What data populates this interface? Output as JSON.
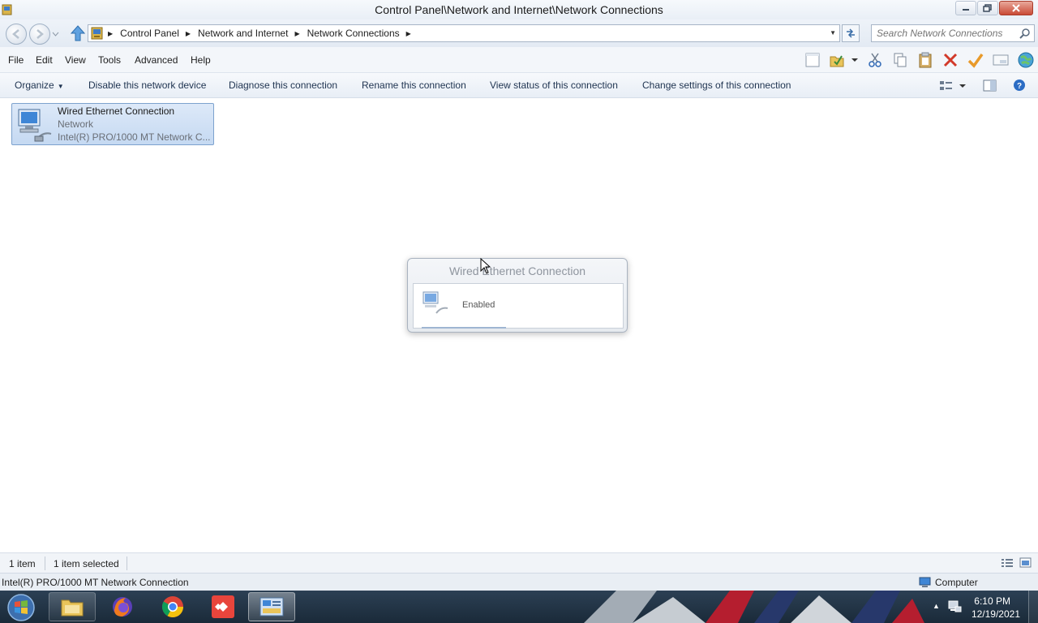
{
  "window": {
    "title": "Control Panel\\Network and Internet\\Network Connections"
  },
  "address": {
    "crumbs": [
      "Control Panel",
      "Network and Internet",
      "Network Connections"
    ],
    "search_placeholder": "Search Network Connections"
  },
  "menu": {
    "items": [
      "File",
      "Edit",
      "View",
      "Tools",
      "Advanced",
      "Help"
    ]
  },
  "commands": {
    "organize": "Organize",
    "disable": "Disable this network device",
    "diagnose": "Diagnose this connection",
    "rename": "Rename this connection",
    "view_status": "View status of this connection",
    "change_settings": "Change settings of this connection"
  },
  "connection": {
    "name": "Wired Ethernet Connection",
    "type": "Network",
    "device": "Intel(R) PRO/1000 MT Network C..."
  },
  "popup": {
    "title": "Wired Ethernet Connection",
    "status": "Enabled"
  },
  "status": {
    "count": "1 item",
    "selected": "1 item selected",
    "details": "Intel(R) PRO/1000 MT Network Connection",
    "zone": "Computer"
  },
  "clock": {
    "time": "6:10 PM",
    "date": "12/19/2021"
  },
  "colors": {
    "selection": "#c5d9f2",
    "taskbar": "#1a2a39",
    "close_button": "#c94a35"
  }
}
